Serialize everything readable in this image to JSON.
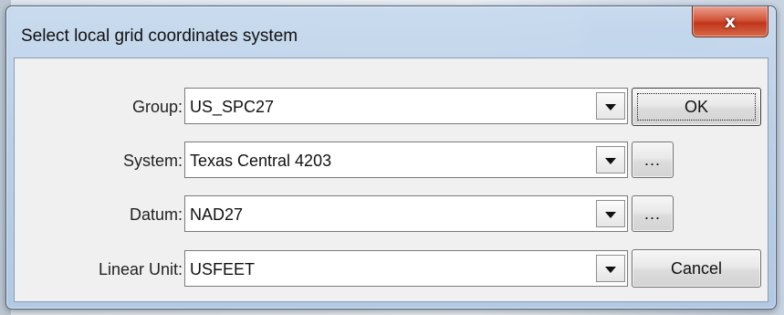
{
  "window": {
    "title": "Select local grid coordinates system",
    "close_glyph": "x"
  },
  "form": {
    "group": {
      "label": "Group:",
      "value": "US_SPC27"
    },
    "system": {
      "label": "System:",
      "value": "Texas Central 4203"
    },
    "datum": {
      "label": "Datum:",
      "value": "NAD27"
    },
    "linear_unit": {
      "label": "Linear Unit:",
      "value": "USFEET"
    }
  },
  "buttons": {
    "ok": "OK",
    "system_browse": "...",
    "datum_browse": "...",
    "cancel": "Cancel"
  },
  "icons": {
    "close": "close-icon",
    "dropdown": "chevron-down-icon"
  },
  "colors": {
    "close_button": "#c8472b",
    "dialog_body": "#f0f0f0",
    "title_bar": "#bcd2ea"
  }
}
